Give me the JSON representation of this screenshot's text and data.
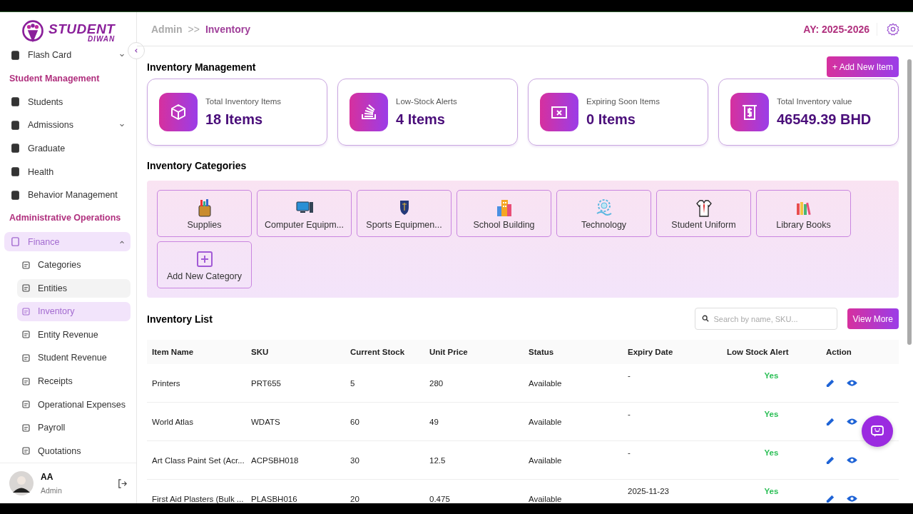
{
  "logo": {
    "line1": "STUDENT",
    "line2": "DIWAN"
  },
  "breadcrumb": {
    "parent": "Admin",
    "separator": ">>",
    "current": "Inventory"
  },
  "academic_year": "AY: 2025-2026",
  "sidebar": {
    "items": [
      {
        "kind": "item",
        "label": "Flash Card",
        "expandable": true,
        "expanded": false,
        "hovered": false
      },
      {
        "kind": "section",
        "label": "Student Management"
      },
      {
        "kind": "item",
        "label": "Students",
        "expandable": false,
        "expanded": false,
        "hovered": false
      },
      {
        "kind": "item",
        "label": "Admissions",
        "expandable": true,
        "expanded": false,
        "hovered": false
      },
      {
        "kind": "item",
        "label": "Graduate",
        "expandable": false,
        "expanded": false,
        "hovered": false
      },
      {
        "kind": "item",
        "label": "Health",
        "expandable": false,
        "expanded": false,
        "hovered": false
      },
      {
        "kind": "item",
        "label": "Behavior Management",
        "expandable": false,
        "expanded": false,
        "hovered": false
      },
      {
        "kind": "section",
        "label": "Administrative Operations"
      },
      {
        "kind": "item",
        "label": "Finance",
        "expandable": true,
        "expanded": true,
        "hovered": false
      },
      {
        "kind": "subitem",
        "label": "Categories",
        "selected": false,
        "hovered": false
      },
      {
        "kind": "subitem",
        "label": "Entities",
        "selected": false,
        "hovered": true
      },
      {
        "kind": "subitem",
        "label": "Inventory",
        "selected": true,
        "hovered": false
      },
      {
        "kind": "subitem",
        "label": "Entity Revenue",
        "selected": false,
        "hovered": false
      },
      {
        "kind": "subitem",
        "label": "Student Revenue",
        "selected": false,
        "hovered": false
      },
      {
        "kind": "subitem",
        "label": "Receipts",
        "selected": false,
        "hovered": false
      },
      {
        "kind": "subitem",
        "label": "Operational Expenses",
        "selected": false,
        "hovered": false
      },
      {
        "kind": "subitem",
        "label": "Payroll",
        "selected": false,
        "hovered": false
      },
      {
        "kind": "subitem",
        "label": "Quotations",
        "selected": false,
        "hovered": false
      }
    ]
  },
  "user": {
    "initials": "AA",
    "role": "Admin"
  },
  "page_title": "Inventory Management",
  "add_button": "+ Add New Item",
  "stats": [
    {
      "kind": "box",
      "label": "Total Inventory Items",
      "value": "18 Items"
    },
    {
      "kind": "stack",
      "label": "Low-Stock Alerts",
      "value": "4 Items"
    },
    {
      "kind": "expire",
      "label": "Expiring Soon Items",
      "value": "0 Items"
    },
    {
      "kind": "money",
      "label": "Total Inventory value",
      "value": "46549.39 BHD"
    }
  ],
  "categories_title": "Inventory Categories",
  "categories": [
    {
      "kind": "supplies",
      "label": "Supplies"
    },
    {
      "kind": "computer",
      "label": "Computer Equipm..."
    },
    {
      "kind": "crest",
      "label": "Sports Equipmen..."
    },
    {
      "kind": "building",
      "label": "School Building"
    },
    {
      "kind": "tech",
      "label": "Technology"
    },
    {
      "kind": "uniform",
      "label": "Student Uniform"
    },
    {
      "kind": "books",
      "label": "Library Books"
    },
    {
      "kind": "add",
      "label": "Add New Category"
    }
  ],
  "list_title": "Inventory List",
  "search": {
    "placeholder": "Search by name, SKU..."
  },
  "view_more": "View More",
  "table": {
    "columns": [
      "Item Name",
      "SKU",
      "Current Stock",
      "Unit Price",
      "Status",
      "Expiry Date",
      "Low Stock Alert",
      "Action"
    ],
    "rows": [
      {
        "name": "Printers",
        "sku": "PRT655",
        "stock": "5",
        "price": "280",
        "status": "Available",
        "expiry": "-",
        "alert": "Yes"
      },
      {
        "name": "World Atlas",
        "sku": "WDATS",
        "stock": "60",
        "price": "49",
        "status": "Available",
        "expiry": "-",
        "alert": "Yes"
      },
      {
        "name": "Art Class Paint Set (Acr...",
        "sku": "ACPSBH018",
        "stock": "30",
        "price": "12.5",
        "status": "Available",
        "expiry": "-",
        "alert": "Yes"
      },
      {
        "name": "First Aid Plasters (Bulk ...",
        "sku": "PLASBH016",
        "stock": "20",
        "price": "0.475",
        "status": "Available",
        "expiry": "2025-11-23",
        "alert": "Yes"
      }
    ]
  }
}
